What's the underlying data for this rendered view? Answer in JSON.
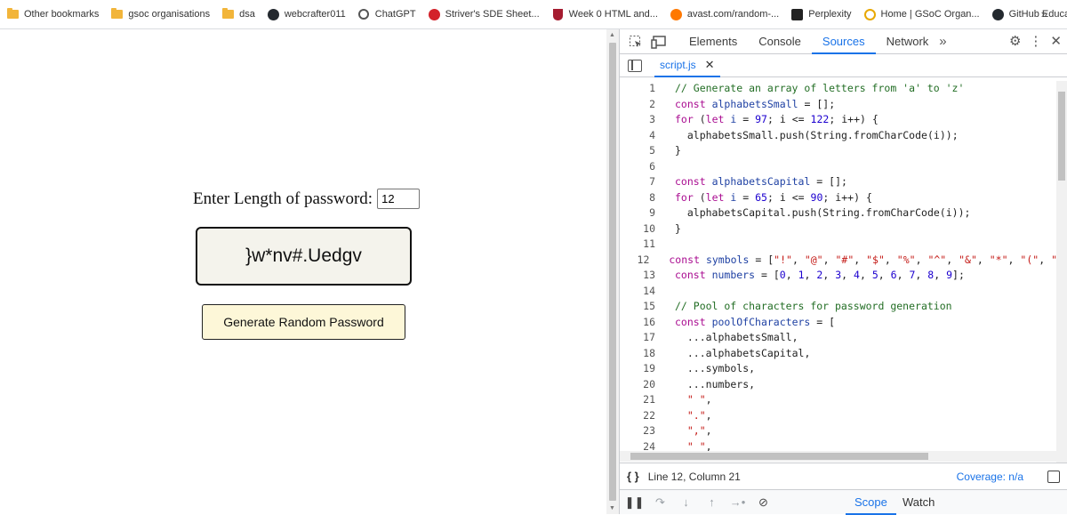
{
  "bookmarks": [
    {
      "label": "Other bookmarks",
      "icon": "folder-icon"
    },
    {
      "label": "gsoc organisations",
      "icon": "folder-icon"
    },
    {
      "label": "dsa",
      "icon": "folder-icon"
    },
    {
      "label": "webcrafter011",
      "icon": "github-icon"
    },
    {
      "label": "ChatGPT",
      "icon": "chatgpt-icon"
    },
    {
      "label": "Striver's SDE Sheet...",
      "icon": "tuf-icon"
    },
    {
      "label": "Week 0 HTML and...",
      "icon": "harvard-icon"
    },
    {
      "label": "avast.com/random-...",
      "icon": "avast-icon"
    },
    {
      "label": "Perplexity",
      "icon": "perplexity-icon"
    },
    {
      "label": "Home | GSoC Organ...",
      "icon": "gsoc-icon"
    },
    {
      "label": "GitHub Education",
      "icon": "github-icon"
    }
  ],
  "bookmarks_overflow": "»",
  "page": {
    "length_label": "Enter Length of password:",
    "length_value": "12",
    "password_output": "}w*nv#.Uedgv",
    "generate_button": "Generate Random Password"
  },
  "devtools": {
    "tabs": [
      "Elements",
      "Console",
      "Sources",
      "Network"
    ],
    "active_tab": "Sources",
    "more_tabs": "»",
    "file_tab": "script.js",
    "close_glyph": "✕",
    "status_position": "Line 12, Column 21",
    "coverage": "Coverage: n/a",
    "braces": "{ }",
    "debug_tabs": [
      "Scope",
      "Watch"
    ]
  },
  "code_lines": [
    {
      "n": "1",
      "text": "// Generate an array of letters from 'a' to 'z'"
    },
    {
      "n": "2",
      "text": "const alphabetsSmall = [];"
    },
    {
      "n": "3",
      "text": "for (let i = 97; i <= 122; i++) {"
    },
    {
      "n": "4",
      "text": "  alphabetsSmall.push(String.fromCharCode(i));"
    },
    {
      "n": "5",
      "text": "}"
    },
    {
      "n": "6",
      "text": ""
    },
    {
      "n": "7",
      "text": "const alphabetsCapital = [];"
    },
    {
      "n": "8",
      "text": "for (let i = 65; i <= 90; i++) {"
    },
    {
      "n": "9",
      "text": "  alphabetsCapital.push(String.fromCharCode(i));"
    },
    {
      "n": "10",
      "text": "}"
    },
    {
      "n": "11",
      "text": ""
    },
    {
      "n": "12",
      "text": "const symbols = [\"!\", \"@\", \"#\", \"$\", \"%\", \"^\", \"&\", \"*\", \"(\", \""
    },
    {
      "n": "13",
      "text": "const numbers = [0, 1, 2, 3, 4, 5, 6, 7, 8, 9];"
    },
    {
      "n": "14",
      "text": ""
    },
    {
      "n": "15",
      "text": "// Pool of characters for password generation"
    },
    {
      "n": "16",
      "text": "const poolOfCharacters = ["
    },
    {
      "n": "17",
      "text": "  ...alphabetsSmall,"
    },
    {
      "n": "18",
      "text": "  ...alphabetsCapital,"
    },
    {
      "n": "19",
      "text": "  ...symbols,"
    },
    {
      "n": "20",
      "text": "  ...numbers,"
    },
    {
      "n": "21",
      "text": "  \" \","
    },
    {
      "n": "22",
      "text": "  \".\","
    },
    {
      "n": "23",
      "text": "  \",\","
    },
    {
      "n": "24",
      "text": "  \" \","
    }
  ],
  "colors": {
    "accent": "#1a73e8",
    "password_box_bg": "#f4f3ec",
    "button_bg": "#fdf7d8"
  }
}
